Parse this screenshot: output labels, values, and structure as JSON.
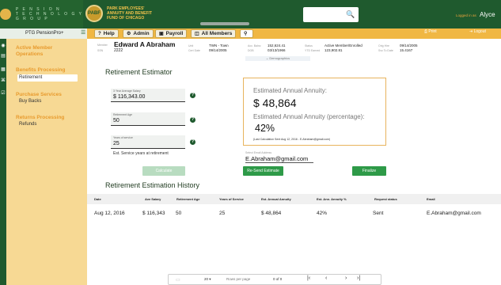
{
  "brand": {
    "text": "P E N S I O N\nT E C H N O L O G Y\nG R O U P"
  },
  "fund": {
    "seal": "PABF",
    "name_line1": "PARK EMPLOYEES'",
    "name_line2": "ANNUITY AND BENEFIT",
    "name_line3": "FUND OF CHICAGO"
  },
  "header": {
    "logged_in_label": "Logged in as",
    "user_name": "Alyce"
  },
  "app": {
    "name": "PTG PensionPro+"
  },
  "tabs": [
    {
      "label": "Help",
      "icon": "?"
    },
    {
      "label": "Admin",
      "icon": "⚙"
    },
    {
      "label": "Payroll",
      "icon": "▣"
    },
    {
      "label": "All Members",
      "icon": "◫"
    },
    {
      "label": "",
      "icon": "⚲"
    }
  ],
  "actions": {
    "print": "⎙ Print",
    "logout": "⇥ Logout"
  },
  "sidebar": {
    "sections": [
      {
        "heading": "Active Member Operations",
        "items": []
      },
      {
        "heading": "Benefits Processing",
        "items": [
          "Retirement"
        ]
      },
      {
        "heading": "Purchase Services",
        "items": [
          "Buy Backs"
        ]
      },
      {
        "heading": "Returns Processing",
        "items": [
          "Refunds"
        ]
      }
    ]
  },
  "member": {
    "name_label": "Member",
    "name": "Edward A Abraham",
    "id_label": "SSN",
    "id": "2222",
    "unit_label": "Unit",
    "unit": "TWN - Town",
    "cert_label": "Cert Date",
    "cert": "09/14/2005",
    "acct_label": "Acc. Balnc",
    "acct": "152,624.41",
    "dob_label": "DOB",
    "dob": "03/13/1966",
    "status_label": "Status",
    "status": "Active Member/Enrolled",
    "ytd_label": "YTD Earned",
    "ytd": "123,902.81",
    "orig_label": "Orig Hire",
    "orig": "09/14/2005",
    "svc_label": "Svc To Date",
    "svc": "15.4167",
    "demographics": "⌄ Demographics"
  },
  "estimator": {
    "title": "Retirement Estimator",
    "salary_label": "3 Year Average Salary",
    "salary_value": "$ 116,343.00",
    "age_label": "Retirement Age",
    "age_value": "50",
    "service_label": "Years of service",
    "service_value": "25",
    "service_hint": "Est. Service years at retirement",
    "annuity_label": "Estimated Annual Annuity:",
    "annuity_value": "$ 48,864",
    "pct_label": "Estimated Annual Annuity (percentage):",
    "pct_value": "42%",
    "note": "(Last Calculation Sent Aug 12, 2016 - E.Abraham@gmail.com)",
    "email_label": "Select Email Address",
    "email_value": "E.Abraham@gmail.com",
    "calc_button": "Calculate",
    "resend_button": "Re-Send Estimate",
    "finalize_button": "Finalize"
  },
  "history": {
    "title": "Retirement Estimation History",
    "columns": [
      "Date",
      "Ave Salary",
      "Retirement Age",
      "Years of Service",
      "Est. Annual Annuity",
      "Est. Ann. Annuity %",
      "Request status",
      "Email"
    ],
    "rows": [
      [
        "Aug 12, 2016",
        "$ 116,343",
        "50",
        "25",
        "$ 48,864",
        "42%",
        "Sent",
        "E.Abraham@gmail.com"
      ]
    ]
  },
  "pager": {
    "page_size": "20",
    "rows_label": "Rows per page",
    "range": "0 of 0"
  }
}
